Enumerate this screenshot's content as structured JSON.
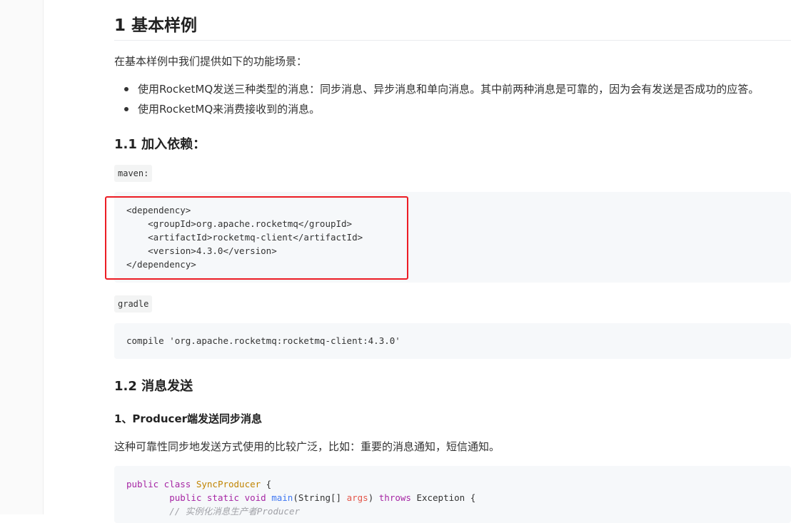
{
  "article": {
    "title": "1 基本样例",
    "intro": "在基本样例中我们提供如下的功能场景：",
    "bullets": [
      "使用RocketMQ发送三种类型的消息：同步消息、异步消息和单向消息。其中前两种消息是可靠的，因为会有发送是否成功的应答。",
      "使用RocketMQ来消费接收到的消息。"
    ],
    "section_1_1": {
      "title": "1.1 加入依赖：",
      "maven_label": "maven:",
      "maven_code": [
        "<dependency>",
        "    <groupId>org.apache.rocketmq</groupId>",
        "    <artifactId>rocketmq-client</artifactId>",
        "    <version>4.3.0</version>",
        "</dependency>"
      ],
      "gradle_label": "gradle",
      "gradle_code": "compile 'org.apache.rocketmq:rocketmq-client:4.3.0'"
    },
    "section_1_2": {
      "title": "1.2 消息发送",
      "sub_title": "1、Producer端发送同步消息",
      "description": "这种可靠性同步地发送方式使用的比较广泛，比如：重要的消息通知，短信通知。",
      "java_code": {
        "line1": {
          "kw": "public class",
          "cls": "SyncProducer",
          "rest": " {"
        },
        "line2": {
          "indent": "        ",
          "kw": "public static void",
          "fn": "main",
          "p1": "(String[] ",
          "arg": "args",
          "p2": ") ",
          "kw2": "throws",
          "rest": " Exception {"
        },
        "line3": {
          "indent": "        ",
          "comment": "// 实例化消息生产者Producer"
        }
      }
    }
  },
  "highlight_color": "#ec1c24",
  "code_bg": "#f6f8fa"
}
